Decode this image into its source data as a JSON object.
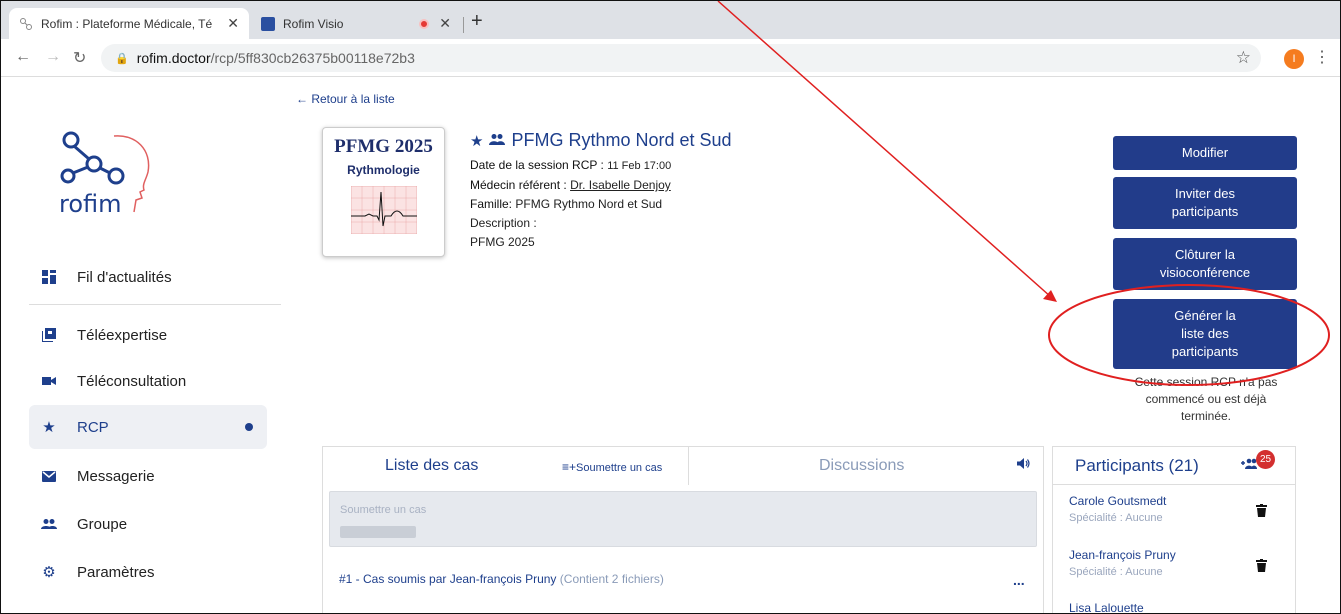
{
  "browser": {
    "tabs": [
      {
        "title": "Rofim : Plateforme Médicale, Té"
      },
      {
        "title": "Rofim Visio"
      }
    ],
    "url_host": "rofim.doctor",
    "url_path": "/rcp/5ff830cb26375b00118e72b3",
    "profile_initial": "I"
  },
  "sidebar": {
    "logo_text": "rofim",
    "items": [
      {
        "label": "Fil d'actualités",
        "icon": "newsfeed-icon"
      },
      {
        "label": "Téléexpertise",
        "icon": "expertise-icon"
      },
      {
        "label": "Téléconsultation",
        "icon": "video-icon"
      },
      {
        "label": "RCP",
        "icon": "star-icon"
      },
      {
        "label": "Messagerie",
        "icon": "mail-icon"
      },
      {
        "label": "Groupe",
        "icon": "group-icon"
      },
      {
        "label": "Paramètres",
        "icon": "gear-icon"
      }
    ]
  },
  "main": {
    "back_link": "← Retour à la liste",
    "thumbnail": {
      "line1": "PFMG 2025",
      "line2": "Rythmologie"
    },
    "title": "PFMG Rythmo Nord et Sud",
    "date_label": "Date de la session RCP :",
    "date_value": "11 Feb 17:00",
    "doctor_label": "Médecin référent :",
    "doctor_value": "Dr. Isabelle Denjoy",
    "family_label": "Famille:",
    "family_value": "PFMG Rythmo Nord et Sud",
    "description_label": "Description :",
    "description_value": "PFMG 2025"
  },
  "actions": {
    "modify": "Modifier",
    "invite_l1": "Inviter des",
    "invite_l2": "participants",
    "close_l1": "Clôturer la",
    "close_l2": "visioconférence",
    "generate_l1": "Générer la",
    "generate_l2": "liste des",
    "generate_l3": "participants",
    "note_l1": "Cette session RCP n'a pas",
    "note_l2": "commencé ou est déjà",
    "note_l3": "terminée."
  },
  "cases": {
    "tab_label": "Liste des cas",
    "submit_link": "Soumettre un cas",
    "discussions_label": "Discussions",
    "placeholder": "Soumettre un cas",
    "case_title": "#1 - Cas soumis par Jean-françois Pruny",
    "case_files": "(Contient 2 fichiers)",
    "case_more": "..."
  },
  "participants": {
    "title": "Participants (21)",
    "badge": "25",
    "list": [
      {
        "name": "Carole Goutsmedt",
        "specialty": "Spécialité : Aucune"
      },
      {
        "name": "Jean-françois Pruny",
        "specialty": "Spécialité : Aucune"
      },
      {
        "name": "Lisa Lalouette",
        "specialty": ""
      }
    ]
  },
  "colors": {
    "brand": "#223c8a",
    "annotation": "#e02020"
  }
}
